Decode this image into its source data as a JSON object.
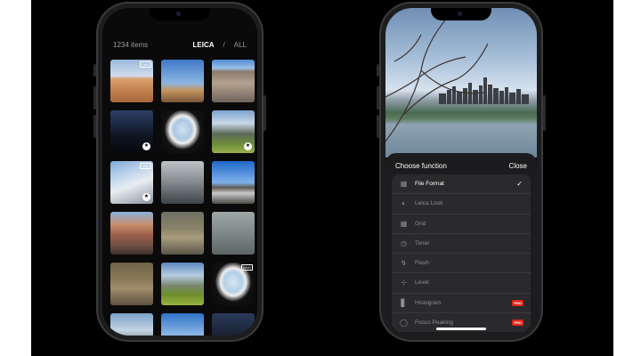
{
  "gallery": {
    "count_label": "1234 items",
    "filter_primary": "LEICA",
    "filter_sep": "/",
    "filter_secondary": "ALL",
    "thumbs": [
      {
        "raw": true,
        "star": false
      },
      {
        "raw": false,
        "star": false
      },
      {
        "raw": false,
        "star": false
      },
      {
        "raw": false,
        "star": true
      },
      {
        "raw": false,
        "star": false
      },
      {
        "raw": false,
        "star": true
      },
      {
        "raw": true,
        "star": true
      },
      {
        "raw": false,
        "star": false
      },
      {
        "raw": false,
        "star": false
      },
      {
        "raw": false,
        "star": false
      },
      {
        "raw": false,
        "star": false
      },
      {
        "raw": false,
        "star": false
      },
      {
        "raw": false,
        "star": false
      },
      {
        "raw": false,
        "star": false
      },
      {
        "raw": true,
        "star": false
      },
      {
        "raw": false,
        "star": false
      },
      {
        "raw": false,
        "star": false
      },
      {
        "raw": false,
        "star": false
      }
    ],
    "raw_label": "DNG"
  },
  "sheet": {
    "title": "Choose function",
    "close_label": "Close",
    "pro_label": "PRO",
    "options": [
      {
        "label": "File Format",
        "icon": "file-format-icon",
        "selected": true,
        "pro": false
      },
      {
        "label": "Leica Look",
        "icon": "leica-look-icon",
        "selected": false,
        "pro": false
      },
      {
        "label": "Grid",
        "icon": "grid-icon",
        "selected": false,
        "pro": false
      },
      {
        "label": "Timer",
        "icon": "timer-icon",
        "selected": false,
        "pro": false
      },
      {
        "label": "Flash",
        "icon": "flash-icon",
        "selected": false,
        "pro": false
      },
      {
        "label": "Level",
        "icon": "level-icon",
        "selected": false,
        "pro": false
      },
      {
        "label": "Histogram",
        "icon": "histogram-icon",
        "selected": false,
        "pro": true
      },
      {
        "label": "Focus Peaking",
        "icon": "focus-peaking-icon",
        "selected": false,
        "pro": true
      }
    ]
  },
  "colors": {
    "accent_pro": "#e0261b",
    "sheet_bg": "#1c1c1e"
  }
}
